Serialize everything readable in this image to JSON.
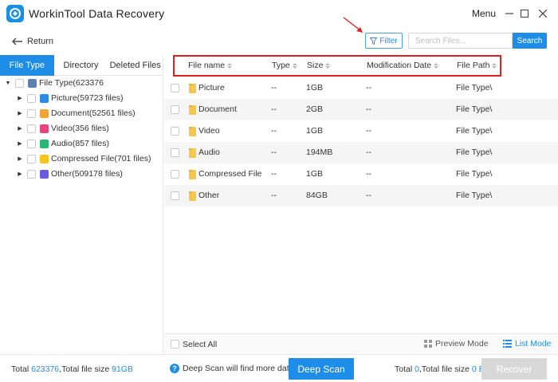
{
  "window": {
    "title": "WorkinTool Data Recovery",
    "menu_label": "Menu"
  },
  "toolbar": {
    "return_label": "Return",
    "filter_label": "Filter",
    "search_placeholder": "Search Files...",
    "search_button": "Search"
  },
  "left_tabs": [
    {
      "label": "File Type",
      "active": true
    },
    {
      "label": "Directory",
      "active": false
    },
    {
      "label": "Deleted Files",
      "active": false
    }
  ],
  "tree": {
    "root": {
      "label": "File Type(623376"
    },
    "items": [
      {
        "label": "Picture(59723 files)",
        "icon_color": "#2a8ae6"
      },
      {
        "label": "Document(52561 files)",
        "icon_color": "#f2a33a"
      },
      {
        "label": "Video(356 files)",
        "icon_color": "#e8457a"
      },
      {
        "label": "Audio(857 files)",
        "icon_color": "#2bb673"
      },
      {
        "label": "Compressed File(701 files)",
        "icon_color": "#f4c420"
      },
      {
        "label": "Other(509178 files)",
        "icon_color": "#6a5ae0"
      }
    ]
  },
  "table": {
    "headers": {
      "name": "File name",
      "type": "Type",
      "size": "Size",
      "date": "Modification Date",
      "path": "File Path"
    },
    "rows": [
      {
        "name": "Picture",
        "type": "--",
        "size": "1GB",
        "date": "--",
        "path": "File Type\\"
      },
      {
        "name": "Document",
        "type": "--",
        "size": "2GB",
        "date": "--",
        "path": "File Type\\"
      },
      {
        "name": "Video",
        "type": "--",
        "size": "1GB",
        "date": "--",
        "path": "File Type\\"
      },
      {
        "name": "Audio",
        "type": "--",
        "size": "194MB",
        "date": "--",
        "path": "File Type\\"
      },
      {
        "name": "Compressed File",
        "type": "--",
        "size": "1GB",
        "date": "--",
        "path": "File Type\\"
      },
      {
        "name": "Other",
        "type": "--",
        "size": "84GB",
        "date": "--",
        "path": "File Type\\"
      }
    ]
  },
  "bottom_bar": {
    "select_all": "Select All",
    "preview_mode": "Preview Mode",
    "list_mode": "List Mode"
  },
  "footer": {
    "total_prefix": "Total ",
    "total_count": "623376",
    "total_size_prefix": ",Total file size ",
    "total_size": "91GB",
    "hint": "Deep Scan will find more data",
    "deep_scan": "Deep Scan",
    "selected_prefix": "Total ",
    "selected_count": "0",
    "selected_size_prefix": ",Total file size ",
    "selected_size": "0 B",
    "recover": "Recover"
  },
  "colors": {
    "accent": "#1e8de8",
    "highlight_border": "#e02020",
    "disabled": "#d8d8d8"
  }
}
